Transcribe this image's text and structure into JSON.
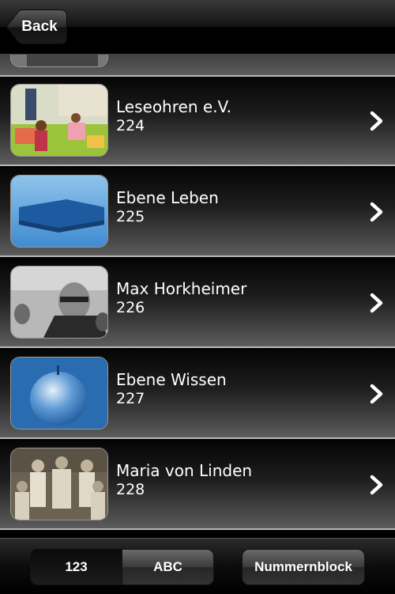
{
  "nav": {
    "back_label": "Back"
  },
  "list": {
    "items": [
      {
        "title": "Leseohren e.V.",
        "number": "224",
        "image": "children-classroom-photo"
      },
      {
        "title": "Ebene Leben",
        "number": "225",
        "image": "blue-puzzle-piece-photo"
      },
      {
        "title": "Max Horkheimer",
        "number": "226",
        "image": "portrait-bw-photo"
      },
      {
        "title": "Ebene Wissen",
        "number": "227",
        "image": "blue-apple-photo"
      },
      {
        "title": "Maria von Linden",
        "number": "228",
        "image": "historic-group-photo"
      }
    ]
  },
  "toolbar": {
    "seg_numeric": "123",
    "seg_alpha": "ABC",
    "numblock_label": "Nummernblock"
  },
  "colors": {
    "row_separator": "#b9b9b9",
    "accent_blue": "#2d6fb3"
  }
}
